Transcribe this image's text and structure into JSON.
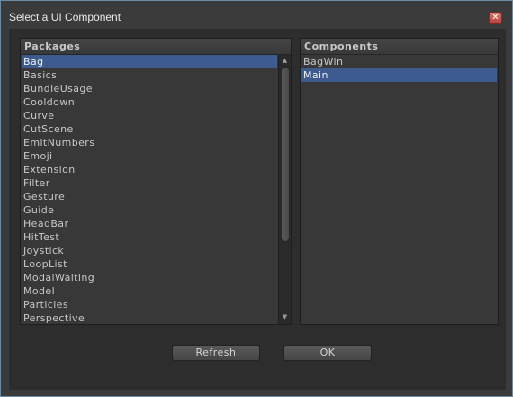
{
  "window": {
    "title": "Select a UI Component",
    "close_glyph": "✕"
  },
  "packages": {
    "header": "Packages",
    "selected_index": 0,
    "items": [
      "Bag",
      "Basics",
      "BundleUsage",
      "Cooldown",
      "Curve",
      "CutScene",
      "EmitNumbers",
      "Emoji",
      "Extension",
      "Filter",
      "Gesture",
      "Guide",
      "HeadBar",
      "HitTest",
      "Joystick",
      "LoopList",
      "ModalWaiting",
      "Model",
      "Particles",
      "Perspective"
    ]
  },
  "components": {
    "header": "Components",
    "selected_index": 1,
    "items": [
      "BagWin",
      "Main"
    ]
  },
  "buttons": {
    "refresh_label": "Refresh",
    "ok_label": "OK"
  },
  "colors": {
    "selection": "#3d5b8f",
    "panel_bg": "#383838",
    "window_border": "#6b8aa6"
  }
}
